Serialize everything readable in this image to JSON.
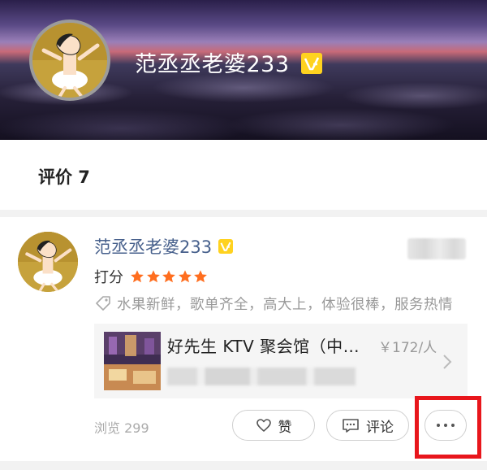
{
  "header": {
    "user_name": "范丞丞老婆233",
    "badge_label": "V"
  },
  "reviews_header": {
    "title": "评价 7"
  },
  "review": {
    "user_name": "范丞丞老婆233",
    "badge_label": "V",
    "rating_label": "打分",
    "rating_stars": 5,
    "tags": "水果新鲜，歌单齐全，高大上，体验很棒，服务热情",
    "shop": {
      "name": "好先生 KTV 聚会馆（中…",
      "price": "￥172/人"
    },
    "views": "浏览 299",
    "actions": {
      "like_label": "赞",
      "comment_label": "评论"
    }
  },
  "colors": {
    "name_link": "#47608c",
    "star": "#ff6e1f",
    "badge": "#ffd21f",
    "highlight_box": "#e8161c"
  },
  "icons": [
    "user-avatar",
    "verified-badge-icon",
    "star-icon",
    "tag-icon",
    "chevron-right-icon",
    "heart-icon",
    "comment-icon",
    "more-icon"
  ]
}
